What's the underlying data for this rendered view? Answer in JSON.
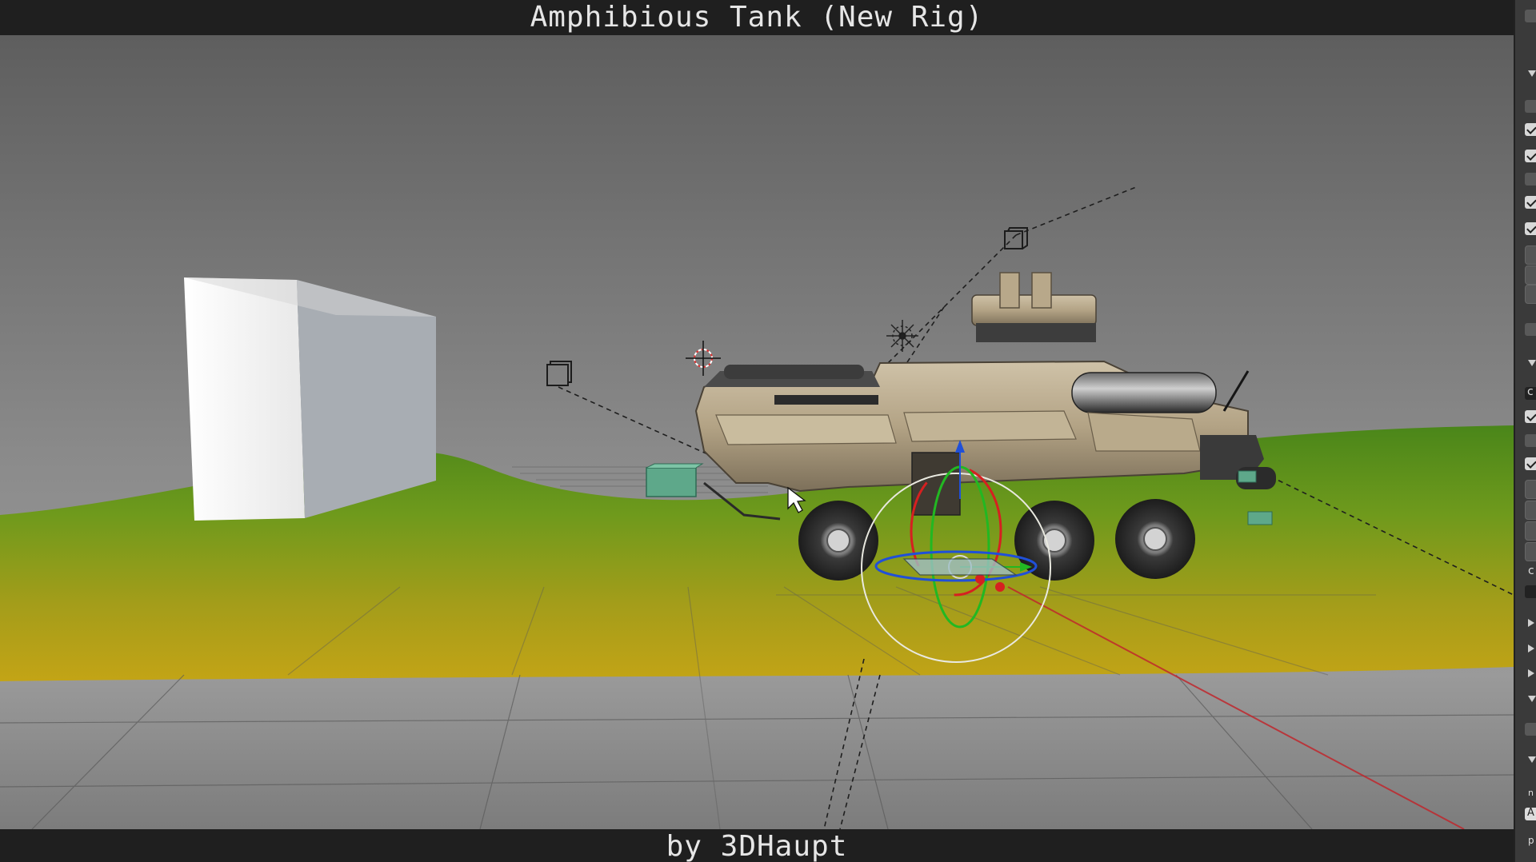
{
  "header": {
    "title": "Amphibious Tank (New Rig)"
  },
  "footer": {
    "caption": "by 3DHaupt"
  },
  "viewport": {
    "colors": {
      "sky_top": "#636363",
      "sky_bottom": "#9a9a9a",
      "grass_dark": "#4f8a1a",
      "grass_light": "#8a9a20",
      "grass_yellow": "#b9a418",
      "floor": "#8e8e8e",
      "tank_body": "#b8a88c",
      "tank_dark": "#3a3a3a",
      "gizmo_x": "#d62020",
      "gizmo_y": "#22b822",
      "gizmo_z": "#2050d8"
    }
  },
  "side_panel": {
    "letters": [
      "c",
      "c",
      "n",
      "A",
      "p"
    ]
  }
}
